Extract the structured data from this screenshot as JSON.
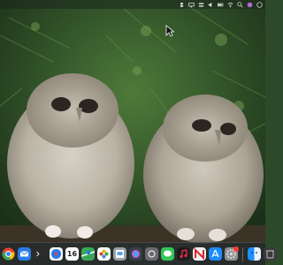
{
  "desktop": {
    "wallpaper": "owl-chicks-photo",
    "accent": "#1f3d1e"
  },
  "menubar": {
    "status_icons": [
      "dropbox-icon",
      "display-icon",
      "control-center-icon",
      "audio-icon",
      "battery-icon",
      "wifi-icon",
      "search-icon",
      "siri-icon",
      "menu-extra-icon"
    ]
  },
  "dock": {
    "apps": [
      {
        "name": "chrome",
        "icon": "chrome-icon",
        "color": "#e84335"
      },
      {
        "name": "mail",
        "icon": "mail-icon",
        "color": "#2a7be4"
      },
      {
        "name": "terminal",
        "icon": "terminal-icon",
        "color": "#2b2b2b"
      },
      {
        "name": "safari",
        "icon": "safari-icon",
        "color": "#1d7cf2"
      },
      {
        "name": "calendar",
        "icon": "calendar-icon",
        "color": "#ffffff",
        "day": "16"
      },
      {
        "name": "maps",
        "icon": "maps-icon",
        "color": "#3aa757"
      },
      {
        "name": "photos",
        "icon": "photos-icon",
        "color": "#ffffff"
      },
      {
        "name": "preview",
        "icon": "preview-icon",
        "color": "#9aa0a6"
      },
      {
        "name": "siri",
        "icon": "siri-app-icon",
        "color": "#3b3f4c"
      },
      {
        "name": "screenshot",
        "icon": "screenshot-icon",
        "color": "#6a6a70"
      },
      {
        "name": "messages",
        "icon": "messages-icon",
        "color": "#34c759"
      },
      {
        "name": "music",
        "icon": "music-icon",
        "color": "#1c1c1e"
      },
      {
        "name": "news",
        "icon": "news-icon",
        "color": "#f2f2f2"
      },
      {
        "name": "app-store",
        "icon": "app-store-icon",
        "color": "#1a8cff"
      },
      {
        "name": "settings",
        "icon": "settings-icon",
        "color": "#8e8e93",
        "badge": true
      },
      {
        "name": "finder",
        "icon": "finder-icon",
        "color": "#1e90ff"
      },
      {
        "name": "trash",
        "icon": "trash-icon",
        "color": "#3a3a3c"
      }
    ]
  }
}
